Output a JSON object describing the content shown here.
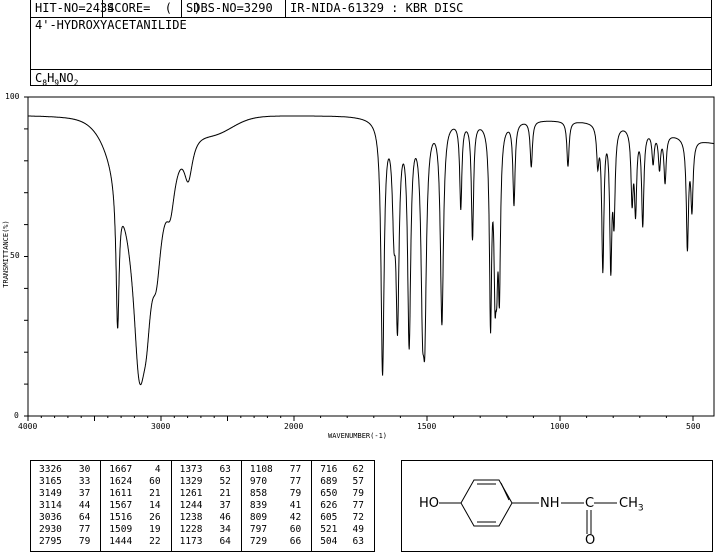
{
  "header": {
    "hit_no": "HIT-NO=2434",
    "score": "SCORE=  (   )",
    "sdbs_no": "SDBS-NO=3290",
    "method": "IR-NIDA-61329 : KBR DISC",
    "compound_name": "4'-HYDROXYACETANILIDE",
    "formula_c": "C",
    "formula_c_sub": "8",
    "formula_h": "H",
    "formula_h_sub": "9",
    "formula_rest": "NO",
    "formula_o_sub": "2"
  },
  "chart_data": {
    "type": "line",
    "title": "",
    "xlabel": "WAVENUMBER(-1)",
    "ylabel": "TRANSMITTANCE(%)",
    "xlim": [
      4000,
      400
    ],
    "ylim": [
      0,
      100
    ],
    "x_ticks": [
      "4000",
      "3000",
      "2000",
      "1500",
      "1000",
      "500"
    ],
    "y_ticks": [
      "100",
      "50",
      "0"
    ],
    "grid": false,
    "peaks": [
      {
        "wavenumber": 3326,
        "transmittance": 30
      },
      {
        "wavenumber": 3165,
        "transmittance": 33
      },
      {
        "wavenumber": 3149,
        "transmittance": 37
      },
      {
        "wavenumber": 3114,
        "transmittance": 44
      },
      {
        "wavenumber": 3036,
        "transmittance": 64
      },
      {
        "wavenumber": 2930,
        "transmittance": 77
      },
      {
        "wavenumber": 2795,
        "transmittance": 79
      },
      {
        "wavenumber": 1667,
        "transmittance": 4
      },
      {
        "wavenumber": 1624,
        "transmittance": 60
      },
      {
        "wavenumber": 1611,
        "transmittance": 21
      },
      {
        "wavenumber": 1567,
        "transmittance": 14
      },
      {
        "wavenumber": 1516,
        "transmittance": 26
      },
      {
        "wavenumber": 1509,
        "transmittance": 19
      },
      {
        "wavenumber": 1444,
        "transmittance": 22
      },
      {
        "wavenumber": 1373,
        "transmittance": 63
      },
      {
        "wavenumber": 1329,
        "transmittance": 52
      },
      {
        "wavenumber": 1261,
        "transmittance": 21
      },
      {
        "wavenumber": 1244,
        "transmittance": 37
      },
      {
        "wavenumber": 1238,
        "transmittance": 46
      },
      {
        "wavenumber": 1228,
        "transmittance": 34
      },
      {
        "wavenumber": 1173,
        "transmittance": 64
      },
      {
        "wavenumber": 1108,
        "transmittance": 77
      },
      {
        "wavenumber": 970,
        "transmittance": 77
      },
      {
        "wavenumber": 858,
        "transmittance": 79
      },
      {
        "wavenumber": 839,
        "transmittance": 41
      },
      {
        "wavenumber": 809,
        "transmittance": 42
      },
      {
        "wavenumber": 797,
        "transmittance": 60
      },
      {
        "wavenumber": 729,
        "transmittance": 66
      },
      {
        "wavenumber": 716,
        "transmittance": 62
      },
      {
        "wavenumber": 689,
        "transmittance": 57
      },
      {
        "wavenumber": 650,
        "transmittance": 79
      },
      {
        "wavenumber": 626,
        "transmittance": 77
      },
      {
        "wavenumber": 605,
        "transmittance": 72
      },
      {
        "wavenumber": 521,
        "transmittance": 49
      },
      {
        "wavenumber": 504,
        "transmittance": 63
      }
    ]
  },
  "structure": {
    "ho": "HO",
    "nh": "NH",
    "c": "C",
    "ch": "CH",
    "ch_sub": "3",
    "o": "O"
  }
}
